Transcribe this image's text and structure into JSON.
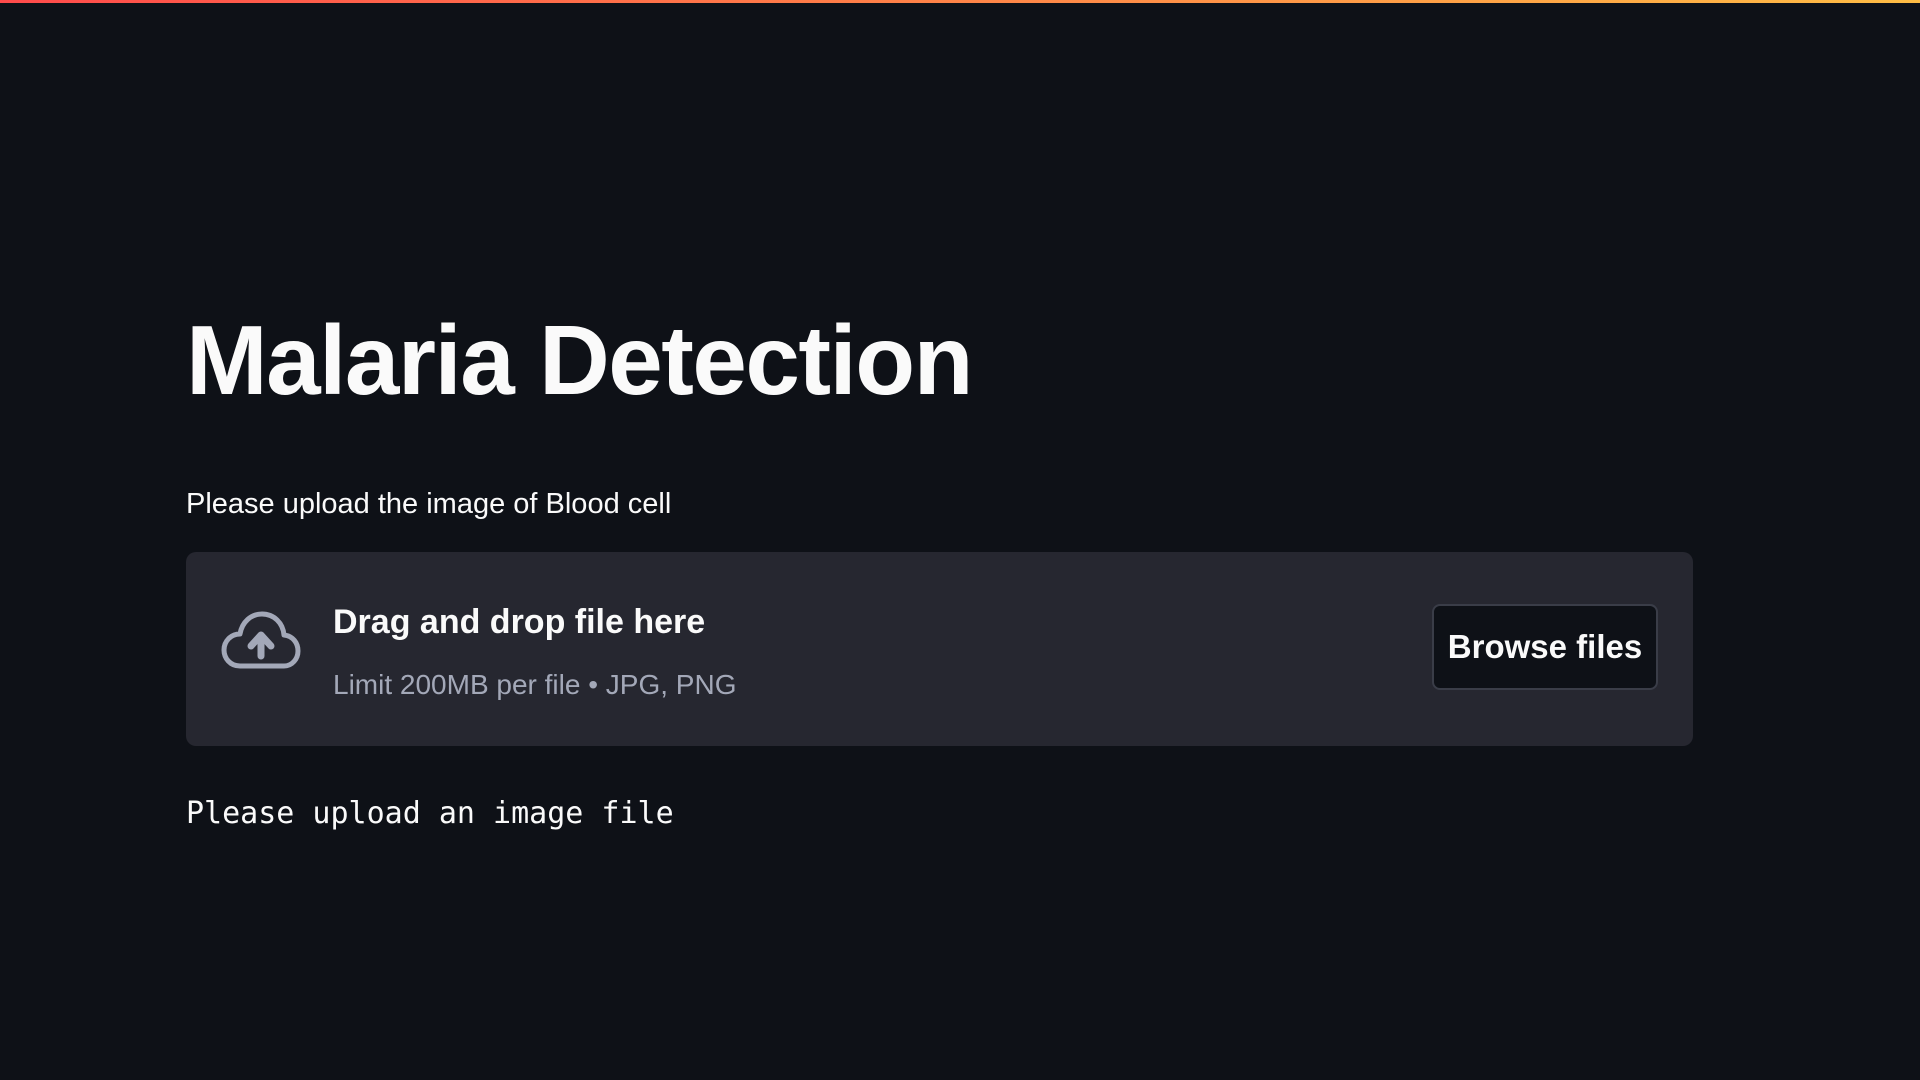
{
  "app": {
    "accent_gradient": [
      "#ff4b4b",
      "#ffbd45"
    ],
    "background": "#0e1117"
  },
  "main": {
    "title": "Malaria Detection",
    "upload_label": "Please upload the image of Blood cell",
    "uploader": {
      "icon": "cloud-upload-icon",
      "drag_text": "Drag and drop file here",
      "limit_text": "Limit 200MB per file • JPG, PNG",
      "browse_label": "Browse files",
      "background": "#262730"
    },
    "status_text": "Please upload an image file"
  }
}
